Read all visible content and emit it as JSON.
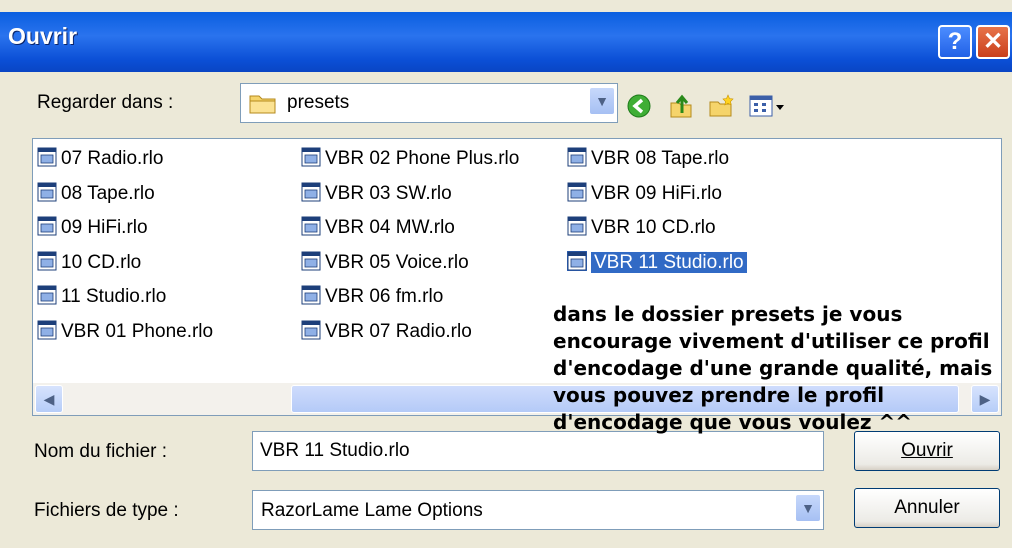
{
  "window": {
    "title": "Ouvrir",
    "help_glyph": "?",
    "close_glyph": "✕"
  },
  "look_in": {
    "label": "Regarder dans :",
    "value": "presets"
  },
  "files": [
    {
      "name": "07 Radio.rlo",
      "selected": false
    },
    {
      "name": "08 Tape.rlo",
      "selected": false
    },
    {
      "name": "09 HiFi.rlo",
      "selected": false
    },
    {
      "name": "10 CD.rlo",
      "selected": false
    },
    {
      "name": "11 Studio.rlo",
      "selected": false
    },
    {
      "name": "VBR 01 Phone.rlo",
      "selected": false
    },
    {
      "name": "VBR 02 Phone Plus.rlo",
      "selected": false
    },
    {
      "name": "VBR 03 SW.rlo",
      "selected": false
    },
    {
      "name": "VBR 04 MW.rlo",
      "selected": false
    },
    {
      "name": "VBR 05 Voice.rlo",
      "selected": false
    },
    {
      "name": "VBR 06 fm.rlo",
      "selected": false
    },
    {
      "name": "VBR 07 Radio.rlo",
      "selected": false
    },
    {
      "name": "VBR 08 Tape.rlo",
      "selected": false
    },
    {
      "name": "VBR 09 HiFi.rlo",
      "selected": false
    },
    {
      "name": "VBR 10 CD.rlo",
      "selected": false
    },
    {
      "name": "VBR 11 Studio.rlo",
      "selected": true
    }
  ],
  "filename": {
    "label": "Nom du fichier :",
    "value": "VBR 11 Studio.rlo"
  },
  "filetype": {
    "label": "Fichiers de type :",
    "value": "RazorLame Lame Options"
  },
  "buttons": {
    "open": "Ouvrir",
    "cancel": "Annuler"
  },
  "annotation": "dans le dossier presets je vous encourage vivement d'utiliser ce profil d'encodage d'une grande qualité, mais vous pouvez prendre le profil d'encodage que vous voulez ^^",
  "colors": {
    "titlebar": "#0a5fe0",
    "selection": "#316ac5",
    "dialog_bg": "#ece9d8"
  }
}
